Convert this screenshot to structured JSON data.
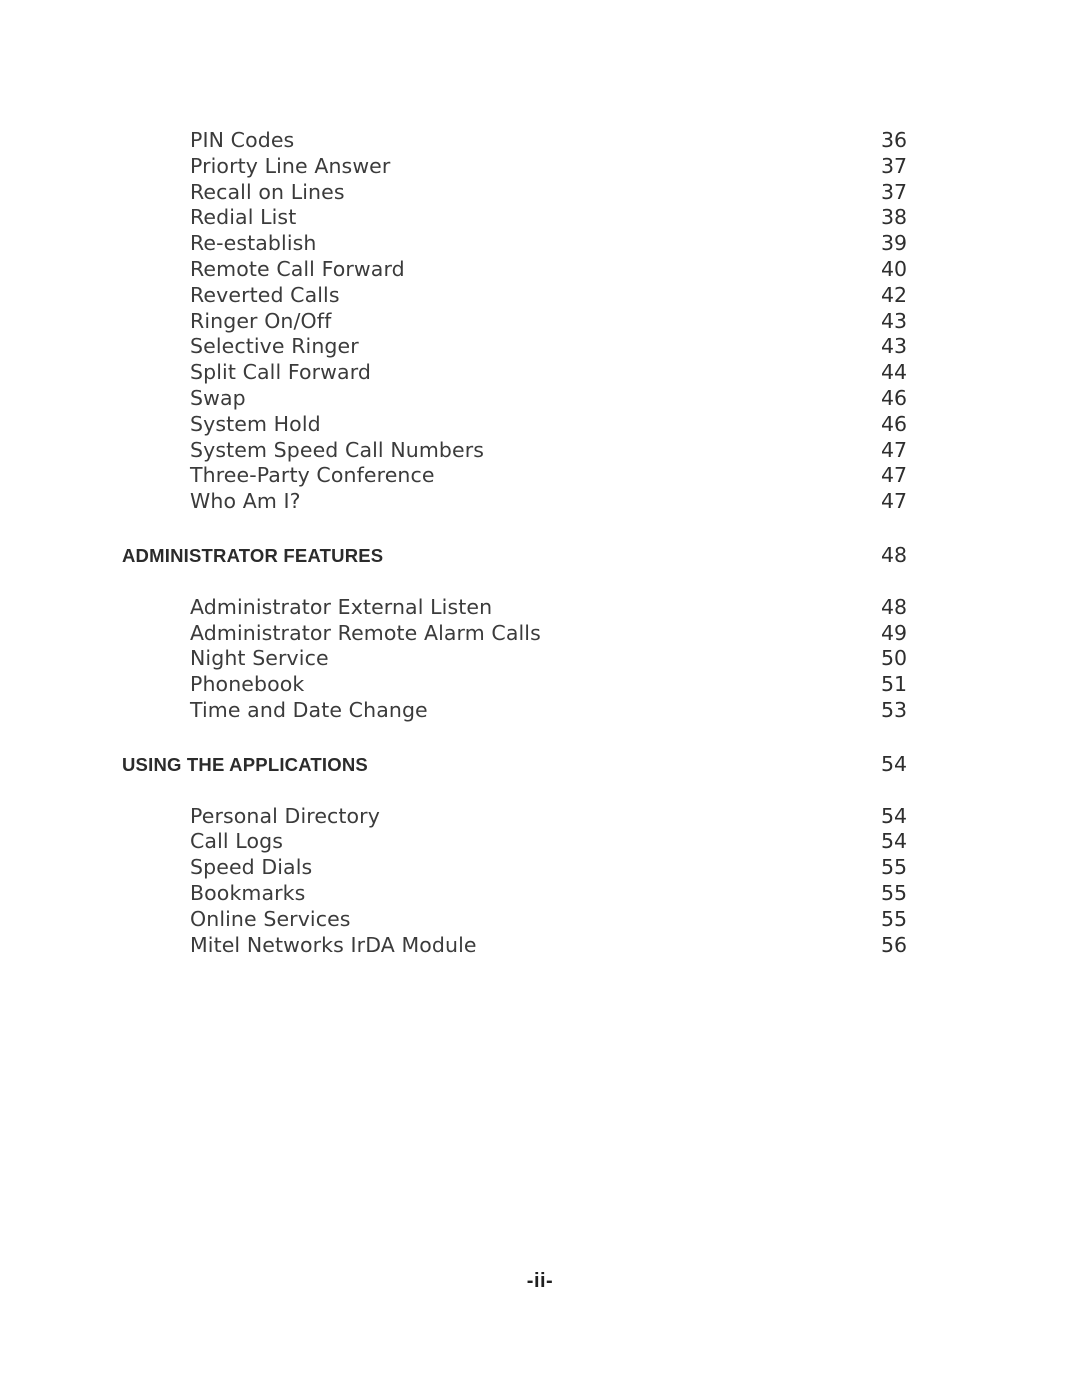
{
  "document": {
    "type": "table-of-contents",
    "folio": "-ii-"
  },
  "colors": {
    "page_background": "#ffffff",
    "entry_text": "#3b3b3b",
    "heading_text": "#2b2b2b",
    "page_number_text": "#2e2e2e"
  },
  "toc": {
    "blocks": [
      {
        "kind": "entries",
        "items": [
          {
            "label": "PIN Codes",
            "page": "36"
          },
          {
            "label": "Priorty Line Answer",
            "page": "37"
          },
          {
            "label": "Recall on Lines",
            "page": "37"
          },
          {
            "label": "Redial List",
            "page": "38"
          },
          {
            "label": "Re-establish",
            "page": "39"
          },
          {
            "label": "Remote Call Forward",
            "page": "40"
          },
          {
            "label": "Reverted Calls",
            "page": "42"
          },
          {
            "label": "Ringer On/Off",
            "page": "43"
          },
          {
            "label": "Selective Ringer",
            "page": "43"
          },
          {
            "label": "Split Call Forward",
            "page": "44"
          },
          {
            "label": "Swap",
            "page": "46"
          },
          {
            "label": "System Hold",
            "page": "46"
          },
          {
            "label": "System Speed Call Numbers",
            "page": "47"
          },
          {
            "label": "Three-Party Conference",
            "page": "47"
          },
          {
            "label": "Who Am I?",
            "page": "47"
          }
        ]
      },
      {
        "kind": "heading",
        "label": "ADMINISTRATOR FEATURES",
        "page": "48"
      },
      {
        "kind": "entries",
        "items": [
          {
            "label": "Administrator External Listen",
            "page": "48"
          },
          {
            "label": "Administrator Remote Alarm Calls",
            "page": "49"
          },
          {
            "label": "Night Service",
            "page": "50"
          },
          {
            "label": "Phonebook",
            "page": "51"
          },
          {
            "label": "Time and Date Change",
            "page": "53"
          }
        ]
      },
      {
        "kind": "heading",
        "label": "USING THE APPLICATIONS",
        "page": "54"
      },
      {
        "kind": "entries",
        "items": [
          {
            "label": "Personal Directory",
            "page": "54"
          },
          {
            "label": "Call Logs",
            "page": "54"
          },
          {
            "label": "Speed Dials",
            "page": "55"
          },
          {
            "label": "Bookmarks",
            "page": "55"
          },
          {
            "label": "Online Services",
            "page": "55"
          },
          {
            "label": "Mitel Networks IrDA Module",
            "page": "56"
          }
        ]
      }
    ]
  }
}
